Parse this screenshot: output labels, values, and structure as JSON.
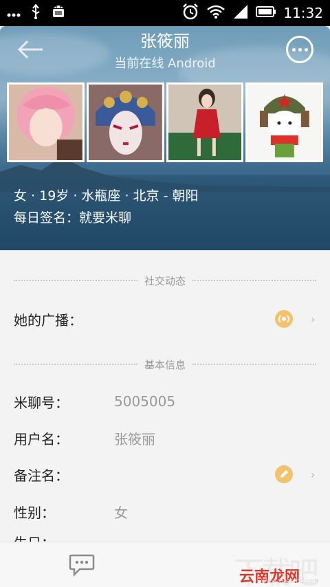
{
  "status_bar": {
    "time": "11:32",
    "icons": [
      "more-icon",
      "usb-icon",
      "android-icon",
      "alarm-icon",
      "wifi-icon",
      "signal-icon",
      "battery-icon"
    ]
  },
  "header": {
    "back_icon": "back-arrow-icon",
    "name": "张筱丽",
    "online_status": "当前在线 Android",
    "more_icon": "more-menu-icon",
    "photos": [
      "pink-wig-photo",
      "opera-mask-photo",
      "christmas-costume-photo",
      "bunny-plush-photo"
    ],
    "info_line": "女 · 19岁 · 水瓶座 · 北京 - 朝阳",
    "signature_line": "每日签名：就要米聊"
  },
  "sections": {
    "social": {
      "title": "社交动态"
    },
    "basic": {
      "title": "基本信息"
    }
  },
  "rows": {
    "broadcast": {
      "label": "她的广播："
    },
    "mi_id": {
      "label": "米聊号：",
      "value": "5005005"
    },
    "username": {
      "label": "用户名：",
      "value": "张筱丽"
    },
    "remark": {
      "label": "备注名："
    },
    "gender": {
      "label": "性别：",
      "value": "女"
    },
    "birthday": {
      "label": "生日："
    }
  },
  "bottom_bar": {
    "chat_icon": "chat-bubble-icon",
    "watermark_text": "下载吧",
    "watermark_red": "云南龙网",
    "watermark_small": "www.xiazaiba.com"
  },
  "colors": {
    "accent_orange": "#f2c26c",
    "text_dark": "#222222",
    "text_gray": "#9a9a9a",
    "background": "#f3f3f3"
  }
}
